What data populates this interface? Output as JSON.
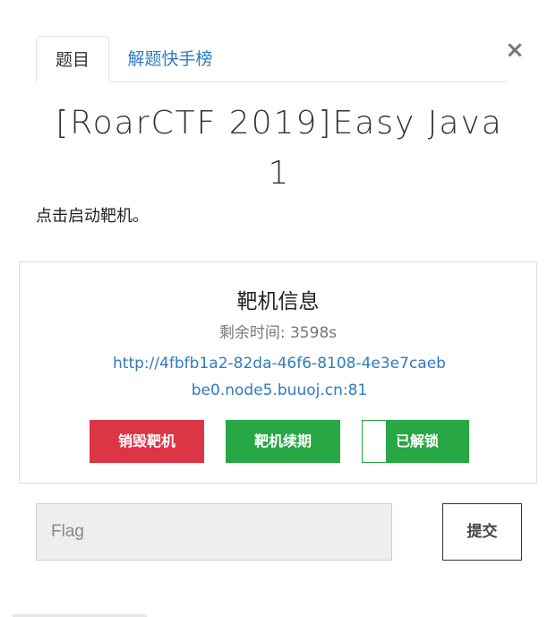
{
  "tabs": {
    "challenge": "题目",
    "leaderboard": "解题快手榜"
  },
  "close_icon": "×",
  "challenge": {
    "title": "[RoarCTF 2019]Easy Java",
    "solves": "1",
    "description": "点击启动靶机。"
  },
  "target": {
    "heading": "靶机信息",
    "remaining": "剩余时间: 3598s",
    "url": "http://4fbfb1a2-82da-46f6-8108-4e3e7caebbe0.node5.buuoj.cn:81",
    "destroy_label": "销毁靶机",
    "renew_label": "靶机续期",
    "solved_label": "已解锁"
  },
  "flag": {
    "placeholder": "Flag",
    "submit_label": "提交"
  },
  "colors": {
    "danger": "#dc3545",
    "success": "#28a745",
    "link": "#2f7bc0"
  }
}
